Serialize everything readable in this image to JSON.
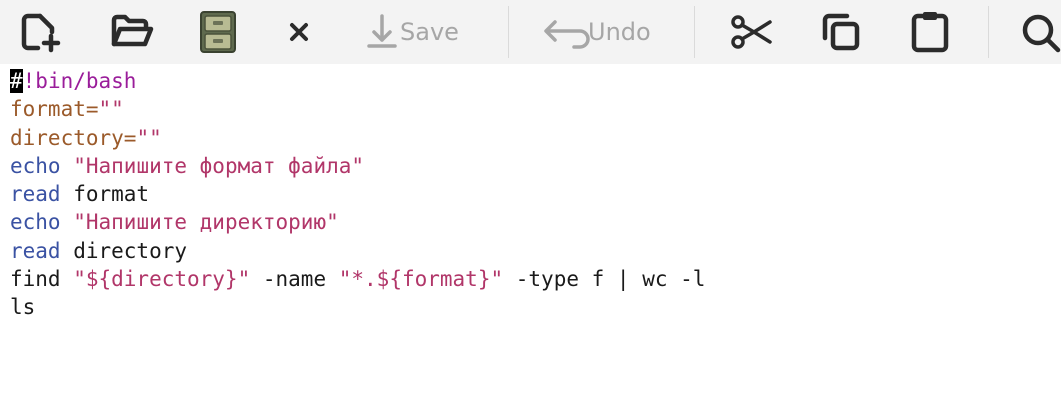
{
  "toolbar": {
    "buttons": [
      {
        "name": "new-file",
        "icon": "new-file-icon"
      },
      {
        "name": "open",
        "icon": "folder-open-icon"
      },
      {
        "name": "save-all",
        "icon": "cabinet-icon"
      },
      {
        "name": "close",
        "icon": "close-icon"
      },
      {
        "name": "save",
        "icon": "download-save-icon",
        "label": "Save",
        "enabled": false
      },
      {
        "name": "undo",
        "icon": "undo-arrow-icon",
        "label": "Undo",
        "enabled": false
      },
      {
        "name": "cut",
        "icon": "scissors-icon"
      },
      {
        "name": "copy",
        "icon": "copy-icon"
      },
      {
        "name": "paste",
        "icon": "clipboard-icon"
      },
      {
        "name": "find",
        "icon": "search-icon"
      }
    ],
    "save_label": "Save",
    "undo_label": "Undo"
  },
  "colors": {
    "toolbar_bg": "#f3f3f3",
    "shebang": "#9a1d9a",
    "variable": "#9b5a2a",
    "string": "#b13669",
    "keyword": "#3a52a3",
    "text": "#1a1a1a"
  },
  "editor": {
    "cursor_char": "#",
    "lines": [
      {
        "tokens": [
          {
            "type": "cursor",
            "text": "#"
          },
          {
            "type": "shebang",
            "text": "!bin/bash"
          }
        ]
      },
      {
        "tokens": [
          {
            "type": "var",
            "text": "format="
          },
          {
            "type": "str",
            "text": "\"\""
          }
        ]
      },
      {
        "tokens": [
          {
            "type": "var",
            "text": "directory="
          },
          {
            "type": "str",
            "text": "\"\""
          }
        ]
      },
      {
        "tokens": [
          {
            "type": "kw",
            "text": "echo"
          },
          {
            "type": "plain",
            "text": " "
          },
          {
            "type": "str",
            "text": "\"Напишите формат файла\""
          }
        ]
      },
      {
        "tokens": [
          {
            "type": "kw",
            "text": "read"
          },
          {
            "type": "plain",
            "text": " format"
          }
        ]
      },
      {
        "tokens": [
          {
            "type": "kw",
            "text": "echo"
          },
          {
            "type": "plain",
            "text": " "
          },
          {
            "type": "str",
            "text": "\"Напишите директорию\""
          }
        ]
      },
      {
        "tokens": [
          {
            "type": "kw",
            "text": "read"
          },
          {
            "type": "plain",
            "text": " directory"
          }
        ]
      },
      {
        "tokens": [
          {
            "type": "plain",
            "text": "find "
          },
          {
            "type": "str",
            "text": "\"${directory}\""
          },
          {
            "type": "plain",
            "text": " -name "
          },
          {
            "type": "str",
            "text": "\"*.${format}\""
          },
          {
            "type": "plain",
            "text": " -type f | wc -l"
          }
        ]
      },
      {
        "tokens": [
          {
            "type": "plain",
            "text": "ls"
          }
        ]
      }
    ]
  }
}
